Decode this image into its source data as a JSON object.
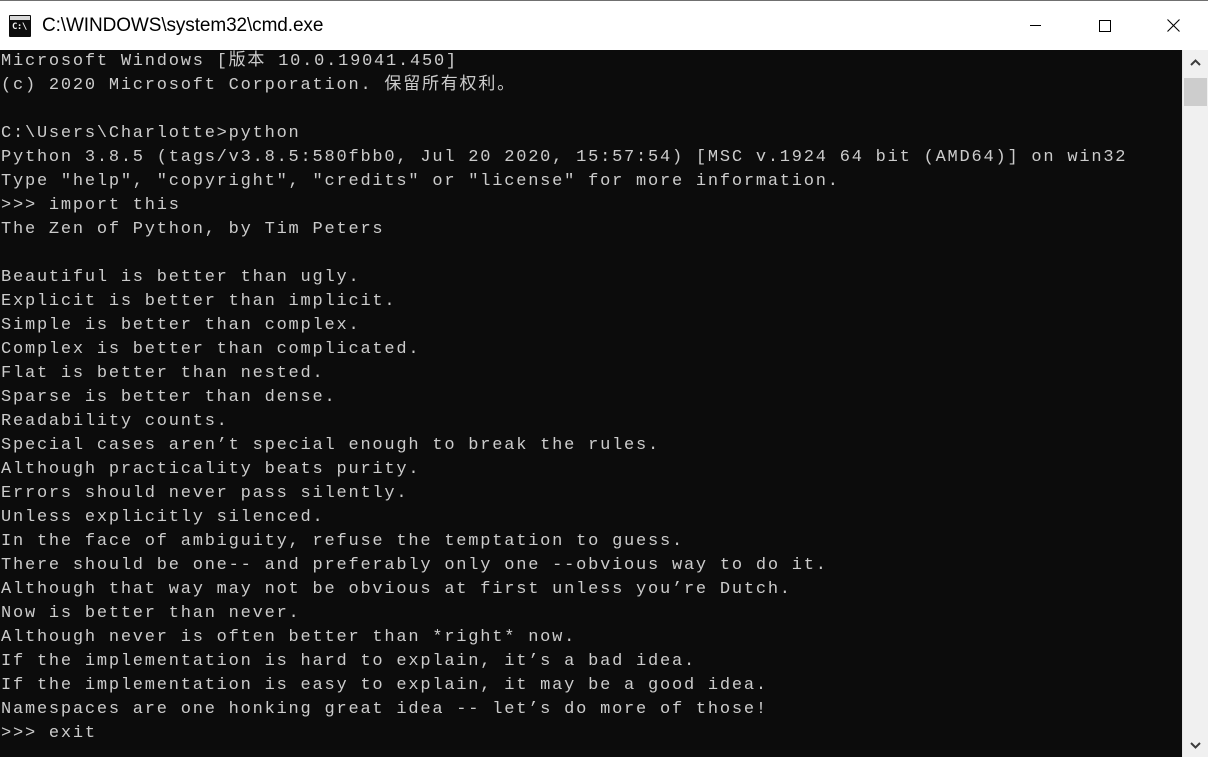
{
  "window": {
    "title": "C:\\WINDOWS\\system32\\cmd.exe",
    "icon_name": "cmd-console-icon",
    "icon_text": "C:\\",
    "colors": {
      "titlebar_bg": "#ffffff",
      "console_bg": "#0c0c0c",
      "console_fg": "#cccccc",
      "scrollbar_bg": "#f0f0f0",
      "scrollbar_thumb": "#cdcdcd"
    },
    "controls": {
      "minimize_label": "Minimize",
      "maximize_label": "Maximize",
      "close_label": "Close"
    }
  },
  "scrollbar": {
    "up_label": "Scroll up",
    "down_label": "Scroll down",
    "thumb_label": "Scroll thumb"
  },
  "console": {
    "lines": [
      "Microsoft Windows [版本 10.0.19041.450]",
      "(c) 2020 Microsoft Corporation. 保留所有权利。",
      "",
      "C:\\Users\\Charlotte>python",
      "Python 3.8.5 (tags/v3.8.5:580fbb0, Jul 20 2020, 15:57:54) [MSC v.1924 64 bit (AMD64)] on win32",
      "Type \"help\", \"copyright\", \"credits\" or \"license\" for more information.",
      ">>> import this",
      "The Zen of Python, by Tim Peters",
      "",
      "Beautiful is better than ugly.",
      "Explicit is better than implicit.",
      "Simple is better than complex.",
      "Complex is better than complicated.",
      "Flat is better than nested.",
      "Sparse is better than dense.",
      "Readability counts.",
      "Special cases aren’t special enough to break the rules.",
      "Although practicality beats purity.",
      "Errors should never pass silently.",
      "Unless explicitly silenced.",
      "In the face of ambiguity, refuse the temptation to guess.",
      "There should be one-- and preferably only one --obvious way to do it.",
      "Although that way may not be obvious at first unless you’re Dutch.",
      "Now is better than never.",
      "Although never is often better than *right* now.",
      "If the implementation is hard to explain, it’s a bad idea.",
      "If the implementation is easy to explain, it may be a good idea.",
      "Namespaces are one honking great idea -- let’s do more of those!",
      ">>> exit"
    ]
  }
}
